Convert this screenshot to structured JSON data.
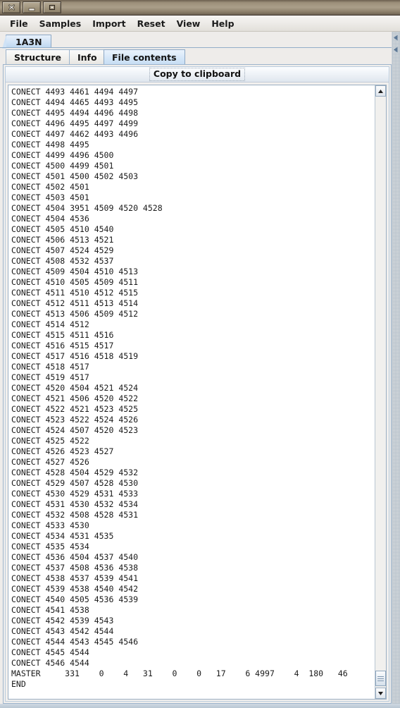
{
  "window": {
    "titlebar_buttons": [
      {
        "name": "close",
        "glyph": "✖"
      },
      {
        "name": "minimize",
        "glyph": "–"
      },
      {
        "name": "maximize",
        "glyph": "□"
      }
    ]
  },
  "menubar": {
    "items": [
      {
        "label": "File"
      },
      {
        "label": "Samples"
      },
      {
        "label": "Import"
      },
      {
        "label": "Reset"
      },
      {
        "label": "View"
      },
      {
        "label": "Help"
      }
    ]
  },
  "tabs_primary": [
    {
      "label": "1A3N",
      "selected": true
    }
  ],
  "tabs_secondary": [
    {
      "label": "Structure",
      "selected": false
    },
    {
      "label": "Info",
      "selected": false
    },
    {
      "label": "File contents",
      "selected": true
    }
  ],
  "toolbar": {
    "copy_label": "Copy to clipboard"
  },
  "file_contents": {
    "lines": [
      "CONECT 4493 4461 4494 4497",
      "CONECT 4494 4465 4493 4495",
      "CONECT 4495 4494 4496 4498",
      "CONECT 4496 4495 4497 4499",
      "CONECT 4497 4462 4493 4496",
      "CONECT 4498 4495",
      "CONECT 4499 4496 4500",
      "CONECT 4500 4499 4501",
      "CONECT 4501 4500 4502 4503",
      "CONECT 4502 4501",
      "CONECT 4503 4501",
      "CONECT 4504 3951 4509 4520 4528",
      "CONECT 4504 4536",
      "CONECT 4505 4510 4540",
      "CONECT 4506 4513 4521",
      "CONECT 4507 4524 4529",
      "CONECT 4508 4532 4537",
      "CONECT 4509 4504 4510 4513",
      "CONECT 4510 4505 4509 4511",
      "CONECT 4511 4510 4512 4515",
      "CONECT 4512 4511 4513 4514",
      "CONECT 4513 4506 4509 4512",
      "CONECT 4514 4512",
      "CONECT 4515 4511 4516",
      "CONECT 4516 4515 4517",
      "CONECT 4517 4516 4518 4519",
      "CONECT 4518 4517",
      "CONECT 4519 4517",
      "CONECT 4520 4504 4521 4524",
      "CONECT 4521 4506 4520 4522",
      "CONECT 4522 4521 4523 4525",
      "CONECT 4523 4522 4524 4526",
      "CONECT 4524 4507 4520 4523",
      "CONECT 4525 4522",
      "CONECT 4526 4523 4527",
      "CONECT 4527 4526",
      "CONECT 4528 4504 4529 4532",
      "CONECT 4529 4507 4528 4530",
      "CONECT 4530 4529 4531 4533",
      "CONECT 4531 4530 4532 4534",
      "CONECT 4532 4508 4528 4531",
      "CONECT 4533 4530",
      "CONECT 4534 4531 4535",
      "CONECT 4535 4534",
      "CONECT 4536 4504 4537 4540",
      "CONECT 4537 4508 4536 4538",
      "CONECT 4538 4537 4539 4541",
      "CONECT 4539 4538 4540 4542",
      "CONECT 4540 4505 4536 4539",
      "CONECT 4541 4538",
      "CONECT 4542 4539 4543",
      "CONECT 4543 4542 4544",
      "CONECT 4544 4543 4545 4546",
      "CONECT 4545 4544",
      "CONECT 4546 4544",
      "MASTER     331    0    4   31    0    0   17    6 4997    4  180   46",
      "END"
    ]
  },
  "scrollbars": {
    "inner_vertical": {
      "position": "bottom"
    },
    "outer_vertical": {
      "position": "top"
    }
  },
  "colors": {
    "titlebar": "#9c8f7a",
    "tab_selected": "#cfe2f6",
    "text": "#1a1a1a",
    "panel": "#f0eeec"
  }
}
